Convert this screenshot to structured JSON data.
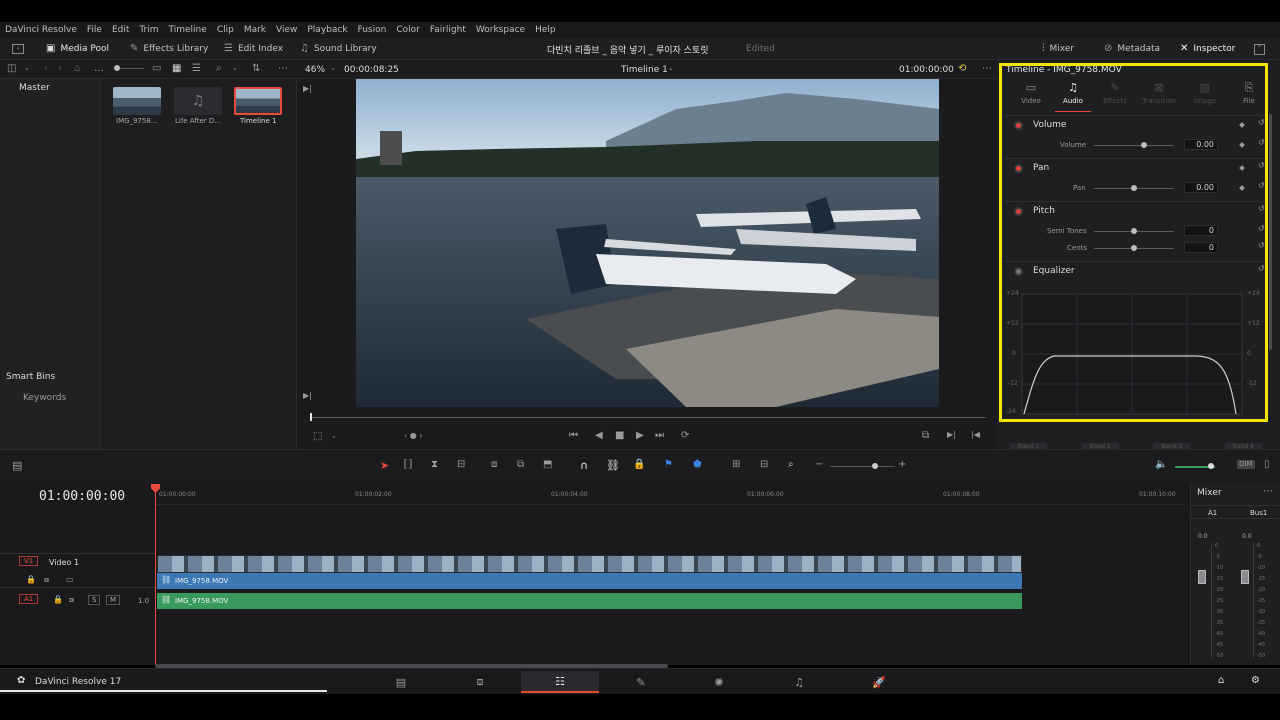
{
  "menu": [
    "DaVinci Resolve",
    "File",
    "Edit",
    "Trim",
    "Timeline",
    "Clip",
    "Mark",
    "View",
    "Playback",
    "Fusion",
    "Color",
    "Fairlight",
    "Workspace",
    "Help"
  ],
  "toolbar": {
    "media_pool": "Media Pool",
    "effects_library": "Effects Library",
    "edit_index": "Edit Index",
    "sound_library": "Sound Library",
    "project_title": "다빈치 리졸브 _ 음악 넣기 _ 루이자 스토릿",
    "edited": "Edited",
    "mixer": "Mixer",
    "metadata": "Metadata",
    "inspector": "Inspector"
  },
  "viewer": {
    "zoom": "46%",
    "timecode": "00:00:08:25",
    "timeline_name": "Timeline 1",
    "record_tc": "01:00:00:00"
  },
  "bins": {
    "master": "Master",
    "smart_bins": "Smart Bins",
    "keywords": "Keywords"
  },
  "clips": [
    {
      "name": "IMG_9758..."
    },
    {
      "name": "Life After D..."
    },
    {
      "name": "Timeline 1"
    }
  ],
  "inspector": {
    "title": "Timeline - IMG_9758.MOV",
    "tabs": [
      "Video",
      "Audio",
      "Effects",
      "Transition",
      "Image",
      "File"
    ],
    "active_tab": "Audio",
    "volume": {
      "header": "Volume",
      "label": "Volume",
      "value": "0.00",
      "level": 0.62
    },
    "pan": {
      "header": "Pan",
      "label": "Pan",
      "value": "0.00",
      "level": 0.5
    },
    "pitch": {
      "header": "Pitch",
      "semitones_label": "Semi Tones",
      "semitones": "0",
      "cents_label": "Cents",
      "cents": "0"
    },
    "equalizer": {
      "header": "Equalizer",
      "db_labels": [
        "+24",
        "+12",
        "0",
        "-12",
        "-24"
      ]
    },
    "bands": [
      "Band 1",
      "Band 2",
      "Band 3",
      "Band 4"
    ]
  },
  "timeline": {
    "timecode": "01:00:00:00",
    "ruler": [
      "01:00:00:00",
      "01:00:02:00",
      "01:00:04:00",
      "01:00:06:00",
      "01:00:08:00",
      "01:00:10:00"
    ],
    "v1": {
      "id": "V1",
      "name": "Video 1",
      "clip": "IMG_9758.MOV"
    },
    "a1": {
      "id": "A1",
      "level": "1.0",
      "clip": "IMG_9758.MOV",
      "s": "S",
      "m": "M"
    }
  },
  "mixer": {
    "title": "Mixer",
    "a1": "A1",
    "bus1": "Bus1",
    "a1_val": "0.0",
    "bus_val": "0.0",
    "scale": [
      "0",
      "-5",
      "-10",
      "-15",
      "-20",
      "-25",
      "-30",
      "-35",
      "-40",
      "-45",
      "-50"
    ]
  },
  "footer": {
    "app": "DaVinci Resolve 17"
  },
  "colors": {
    "accent_red": "#e64b3c",
    "highlight": "#f2e600",
    "video_clip": "#3b78b4",
    "audio_clip": "#3a9a5e"
  }
}
